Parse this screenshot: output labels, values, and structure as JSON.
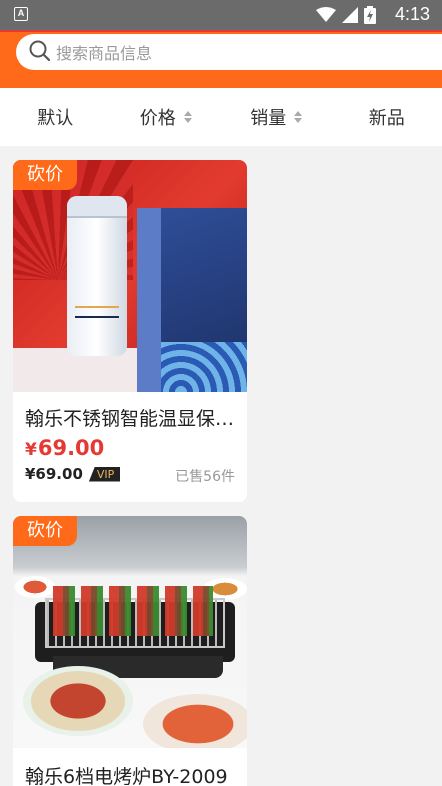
{
  "status_bar": {
    "app_badge": "A",
    "time": "4:13",
    "icons": [
      "wifi-icon",
      "cell-signal-icon",
      "battery-icon"
    ]
  },
  "search": {
    "placeholder": "搜索商品信息"
  },
  "sort_bar": {
    "items": [
      {
        "label": "默认",
        "sortable": false
      },
      {
        "label": "价格",
        "sortable": true
      },
      {
        "label": "销量",
        "sortable": true
      },
      {
        "label": "新品",
        "sortable": false
      }
    ]
  },
  "products": [
    {
      "badge": "砍价",
      "title": "翰乐不锈钢智能温显保温杯套装",
      "price_symbol": "¥",
      "price": "69.00",
      "vip_price": "¥69.00",
      "vip_label": "VIP",
      "sold": "已售56件"
    },
    {
      "badge": "砍价",
      "title": "翰乐6档电烤炉BY-2009"
    }
  ],
  "colors": {
    "accent": "#ff6a1a",
    "price": "#e53935",
    "status_bar": "#6b6b6b"
  }
}
